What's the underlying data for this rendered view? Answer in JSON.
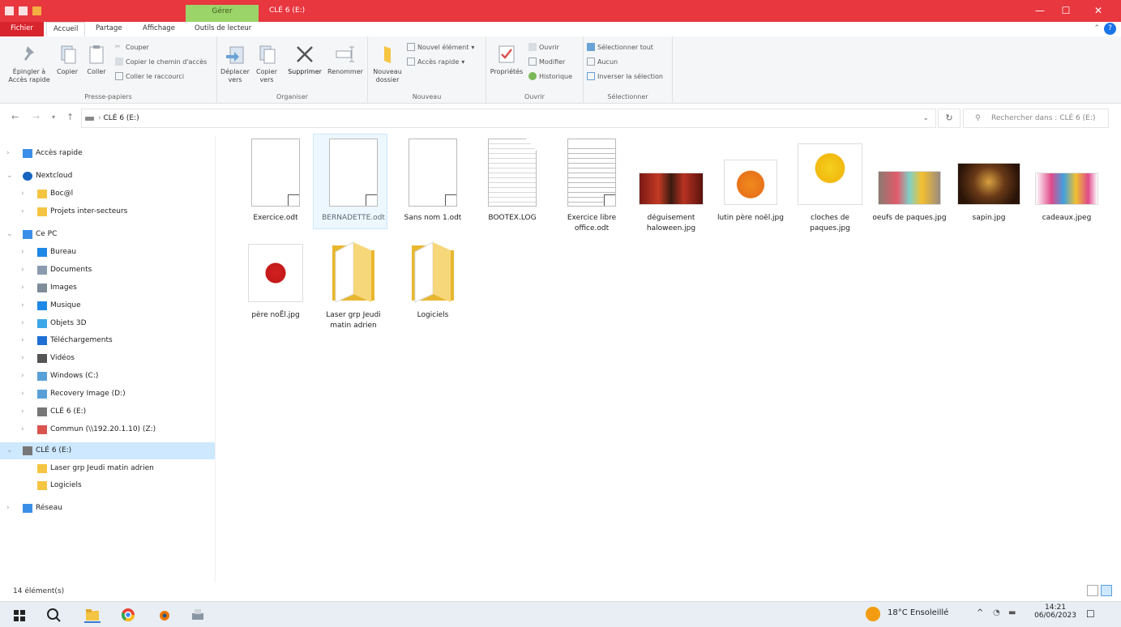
{
  "window": {
    "title": "CLÉ 6 (E:)",
    "context_tab": "Gérer",
    "accent": "#e8373f"
  },
  "tabs": [
    "Fichier",
    "Accueil",
    "Partage",
    "Affichage",
    "Outils de lecteur"
  ],
  "ribbon": {
    "clipboard": {
      "pin": "Épingler à Accès rapide",
      "copy": "Copier",
      "paste": "Coller",
      "cut": "Couper",
      "copy_path": "Copier le chemin d'accès",
      "paste_shortcut": "Coller le raccourci",
      "label": "Presse-papiers"
    },
    "organize": {
      "move": "Déplacer vers",
      "copy_to": "Copier vers",
      "delete": "Supprimer",
      "rename": "Renommer",
      "label": "Organiser"
    },
    "new": {
      "new_folder": "Nouveau dossier",
      "new_item": "Nouvel élément",
      "easy_access": "Accès rapide",
      "label": "Nouveau"
    },
    "open": {
      "properties": "Propriétés",
      "open": "Ouvrir",
      "edit": "Modifier",
      "history": "Historique",
      "label": "Ouvrir"
    },
    "select": {
      "select_all": "Sélectionner tout",
      "select_none": "Aucun",
      "invert": "Inverser la sélection",
      "label": "Sélectionner"
    }
  },
  "address": {
    "path": "CLÉ 6 (E:)",
    "search_placeholder": "Rechercher dans : CLÉ 6 (E:)"
  },
  "nav": [
    {
      "label": "Accès rapide",
      "level": 0,
      "icon": "star-icon"
    },
    {
      "label": "Nextcloud",
      "level": 0,
      "icon": "cloud-icon"
    },
    {
      "label": "Boc@l",
      "level": 1,
      "icon": "folder-icon"
    },
    {
      "label": "Projets inter-secteurs",
      "level": 1,
      "icon": "folder-icon"
    },
    {
      "label": "Ce PC",
      "level": 0,
      "icon": "pc-icon"
    },
    {
      "label": "Bureau",
      "level": 1,
      "icon": "desktop-icon"
    },
    {
      "label": "Documents",
      "level": 1,
      "icon": "documents-icon"
    },
    {
      "label": "Images",
      "level": 1,
      "icon": "images-icon"
    },
    {
      "label": "Musique",
      "level": 1,
      "icon": "music-icon"
    },
    {
      "label": "Objets 3D",
      "level": 1,
      "icon": "cube-icon"
    },
    {
      "label": "Téléchargements",
      "level": 1,
      "icon": "download-icon"
    },
    {
      "label": "Vidéos",
      "level": 1,
      "icon": "video-icon"
    },
    {
      "label": "Windows (C:)",
      "level": 1,
      "icon": "drive-icon"
    },
    {
      "label": "Recovery Image (D:)",
      "level": 1,
      "icon": "drive-icon"
    },
    {
      "label": "CLÉ 6 (E:)",
      "level": 1,
      "icon": "usb-drive-icon"
    },
    {
      "label": "Commun (\\\\192.20.1.10) (Z:)",
      "level": 1,
      "icon": "network-drive-icon"
    },
    {
      "label": "CLÉ 6 (E:)",
      "level": 0,
      "icon": "usb-drive-icon",
      "selected": true
    },
    {
      "label": "Laser grp Jeudi matin adrien",
      "level": 1,
      "icon": "folder-icon"
    },
    {
      "label": "Logiciels",
      "level": 1,
      "icon": "folder-icon"
    },
    {
      "label": "Réseau",
      "level": 0,
      "icon": "network-icon"
    }
  ],
  "files": [
    {
      "name": "Exercice.odt",
      "kind": "odt"
    },
    {
      "name": "BERNADETTE.odt",
      "kind": "odt",
      "selected": true
    },
    {
      "name": "Sans nom 1.odt",
      "kind": "odt"
    },
    {
      "name": "BOOTEX.LOG",
      "kind": "log"
    },
    {
      "name": "Exercice libre office.odt",
      "kind": "odt-text"
    },
    {
      "name": "déguisement haloween.jpg",
      "kind": "jpg"
    },
    {
      "name": "lutin père noël.jpg",
      "kind": "jpg"
    },
    {
      "name": "cloches de paques.jpg",
      "kind": "jpg"
    },
    {
      "name": "oeufs de paques.jpg",
      "kind": "jpg"
    },
    {
      "name": "sapin.jpg",
      "kind": "jpg"
    },
    {
      "name": "cadeaux.jpeg",
      "kind": "jpg"
    },
    {
      "name": "père noËl.jpg",
      "kind": "jpg"
    },
    {
      "name": "Laser grp Jeudi matin adrien",
      "kind": "folder"
    },
    {
      "name": "Logiciels",
      "kind": "folder"
    }
  ],
  "status": {
    "count": "14 élément(s)"
  },
  "taskbar": {
    "weather": "18°C Ensoleillé",
    "time": "14:21",
    "date": "06/06/2023"
  }
}
